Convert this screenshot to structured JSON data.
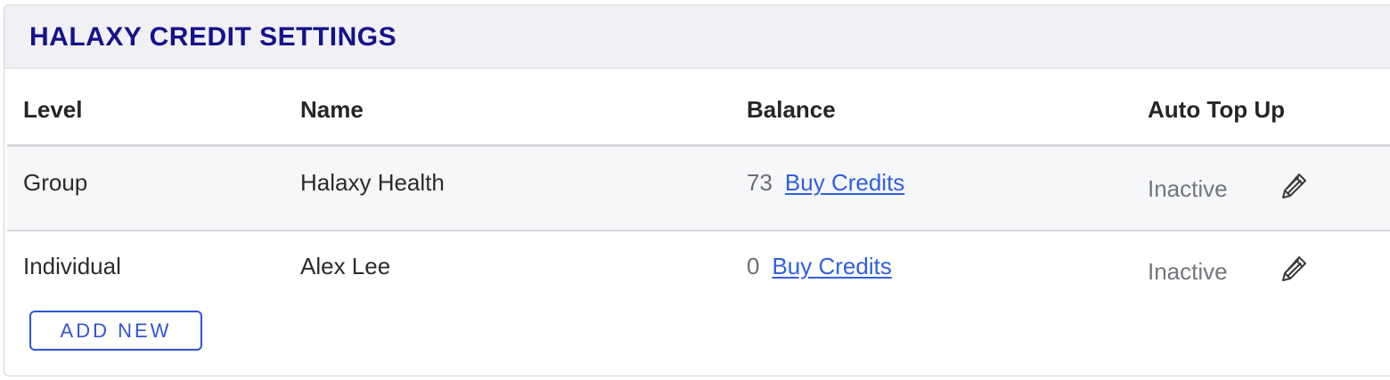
{
  "panel": {
    "title": "HALAXY CREDIT SETTINGS"
  },
  "table": {
    "columns": [
      "Level",
      "Name",
      "Balance",
      "Auto Top Up"
    ],
    "rows": [
      {
        "level": "Group",
        "name": "Halaxy Health",
        "balance": "73",
        "buy_label": "Buy Credits",
        "auto_top_up": "Inactive",
        "edit_icon": "pencil-icon"
      },
      {
        "level": "Individual",
        "name": "Alex Lee",
        "balance": "0",
        "buy_label": "Buy Credits",
        "auto_top_up": "Inactive",
        "edit_icon": "pencil-icon"
      }
    ]
  },
  "actions": {
    "add_new_label": "ADD NEW"
  },
  "colors": {
    "title": "#15128c",
    "link": "#2f5fe0",
    "button": "#2f55d4",
    "header_bg": "#f1f1f5",
    "row_alt_bg": "#f6f7f9"
  }
}
